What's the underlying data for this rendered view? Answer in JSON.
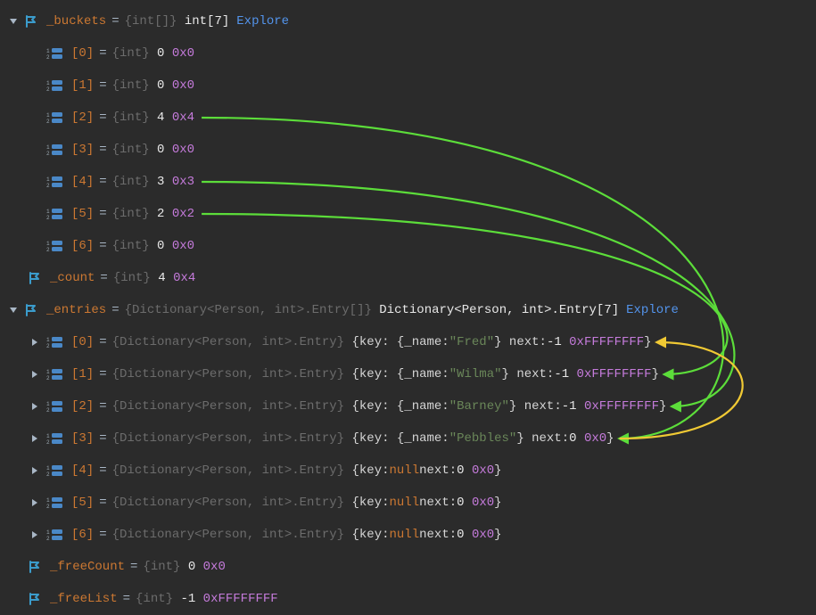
{
  "colors": {
    "green": "#5cdd3a",
    "yellow": "#f0c934"
  },
  "buckets": {
    "name": "_buckets",
    "typeDim": "{int[]}",
    "typeBright": "int[7]",
    "explore": "Explore",
    "items": [
      {
        "idx": "[0]",
        "type": "{int}",
        "num": "0",
        "hex": "0x0"
      },
      {
        "idx": "[1]",
        "type": "{int}",
        "num": "0",
        "hex": "0x0"
      },
      {
        "idx": "[2]",
        "type": "{int}",
        "num": "4",
        "hex": "0x4"
      },
      {
        "idx": "[3]",
        "type": "{int}",
        "num": "0",
        "hex": "0x0"
      },
      {
        "idx": "[4]",
        "type": "{int}",
        "num": "3",
        "hex": "0x3"
      },
      {
        "idx": "[5]",
        "type": "{int}",
        "num": "2",
        "hex": "0x2"
      },
      {
        "idx": "[6]",
        "type": "{int}",
        "num": "0",
        "hex": "0x0"
      }
    ]
  },
  "count": {
    "name": "_count",
    "type": "{int}",
    "num": "4",
    "hex": "0x4"
  },
  "entries": {
    "name": "_entries",
    "typeDim": "{Dictionary<Person, int>.Entry[]}",
    "typeBright": "Dictionary<Person, int>.Entry[7]",
    "explore": "Explore",
    "items": [
      {
        "idx": "[0]",
        "type": "{Dictionary<Person, int>.Entry}",
        "keyPrefix": "{key: {_name: ",
        "name": "\"Fred\"",
        "keySuffix": "}  next: ",
        "nextNum": "-1",
        "nextHex": "0xFFFFFFFF",
        "close": "}"
      },
      {
        "idx": "[1]",
        "type": "{Dictionary<Person, int>.Entry}",
        "keyPrefix": "{key: {_name: ",
        "name": "\"Wilma\"",
        "keySuffix": "}  next: ",
        "nextNum": "-1",
        "nextHex": "0xFFFFFFFF",
        "close": "}"
      },
      {
        "idx": "[2]",
        "type": "{Dictionary<Person, int>.Entry}",
        "keyPrefix": "{key: {_name: ",
        "name": "\"Barney\"",
        "keySuffix": "}  next: ",
        "nextNum": "-1",
        "nextHex": "0xFFFFFFFF",
        "close": "}"
      },
      {
        "idx": "[3]",
        "type": "{Dictionary<Person, int>.Entry}",
        "keyPrefix": "{key: {_name: ",
        "name": "\"Pebbles\"",
        "keySuffix": "}  next: ",
        "nextNum": "0",
        "nextHex": "0x0",
        "close": "}"
      },
      {
        "idx": "[4]",
        "type": "{Dictionary<Person, int>.Entry}",
        "keyPrefix": "{key: ",
        "name": "null",
        "keySuffix": "  next: ",
        "nextNum": "0",
        "nextHex": "0x0",
        "close": "}",
        "isNull": true
      },
      {
        "idx": "[5]",
        "type": "{Dictionary<Person, int>.Entry}",
        "keyPrefix": "{key: ",
        "name": "null",
        "keySuffix": "  next: ",
        "nextNum": "0",
        "nextHex": "0x0",
        "close": "}",
        "isNull": true
      },
      {
        "idx": "[6]",
        "type": "{Dictionary<Person, int>.Entry}",
        "keyPrefix": "{key: ",
        "name": "null",
        "keySuffix": "  next: ",
        "nextNum": "0",
        "nextHex": "0x0",
        "close": "}",
        "isNull": true
      }
    ]
  },
  "freeCount": {
    "name": "_freeCount",
    "type": "{int}",
    "num": "0",
    "hex": "0x0"
  },
  "freeList": {
    "name": "_freeList",
    "type": "{int}",
    "num": "-1",
    "hex": "0xFFFFFFFF"
  },
  "arrows": [
    {
      "from_bucket": 2,
      "to_entry": 3,
      "color": "green"
    },
    {
      "from_bucket": 4,
      "to_entry": 2,
      "color": "green"
    },
    {
      "from_bucket": 5,
      "to_entry": 1,
      "color": "green"
    },
    {
      "from_entry": 3,
      "to_entry": 0,
      "color": "yellow"
    }
  ]
}
